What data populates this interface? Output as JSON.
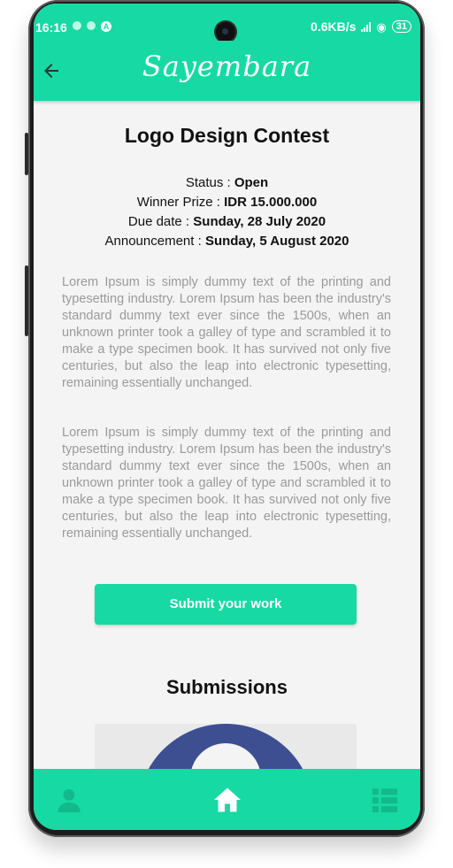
{
  "status_bar": {
    "time": "16:16",
    "network": "0.6KB/s",
    "battery": "31"
  },
  "app_bar": {
    "brand": "Sayembara",
    "back_icon": "arrow-left-icon"
  },
  "contest": {
    "title": "Logo Design Contest",
    "status_label": "Status : ",
    "status_value": "Open",
    "prize_label": "Winner Prize : ",
    "prize_value": "IDR 15.000.000",
    "due_label": "Due date : ",
    "due_value": "Sunday, 28 July 2020",
    "announcement_label": "Announcement : ",
    "announcement_value": "Sunday, 5 August 2020",
    "description_1": "Lorem Ipsum is simply dummy text of the printing and typesetting industry. Lorem Ipsum has been the industry's standard dummy text ever since the 1500s, when an unknown printer took a galley of type and scrambled it to make a type specimen book. It has survived not only five centuries, but also the leap into electronic typesetting, remaining essentially unchanged.",
    "description_2": "Lorem Ipsum is simply dummy text of the printing and typesetting industry. Lorem Ipsum has been the industry's standard dummy text ever since the 1500s, when an unknown printer took a galley of type and scrambled it to make a type specimen book. It has survived not only five centuries, but also the leap into electronic typesetting, remaining essentially unchanged."
  },
  "submit_button": "Submit your work",
  "submissions": {
    "title": "Submissions"
  },
  "bottom_nav": {
    "items": [
      {
        "icon": "person-icon",
        "active": false
      },
      {
        "icon": "home-icon",
        "active": true
      },
      {
        "icon": "list-icon",
        "active": false
      }
    ]
  },
  "colors": {
    "accent": "#17d9a3",
    "accent_dark": "#12b98a",
    "thumb_blue": "#3d4e91",
    "body_text": "#9a9a9a"
  }
}
